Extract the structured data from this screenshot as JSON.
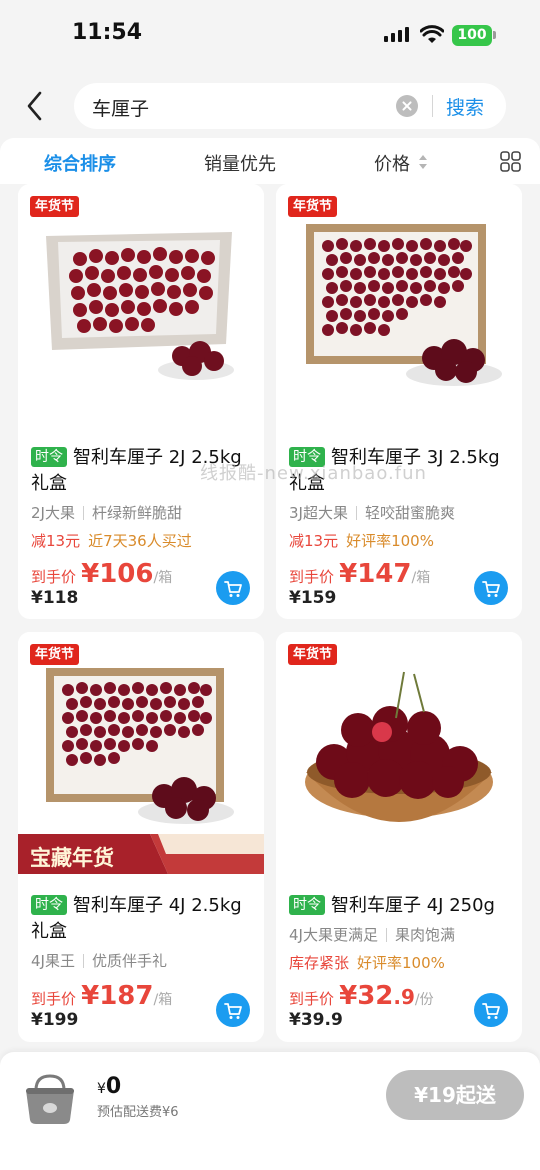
{
  "status_bar": {
    "time": "11:54",
    "battery": "100"
  },
  "search": {
    "query": "车厘子",
    "button_label": "搜索"
  },
  "sort_bar": {
    "tabs": [
      "综合排序",
      "销量优先",
      "价格"
    ]
  },
  "watermark": "线报酷-new.xianbao.fun",
  "products": [
    {
      "tag": "年货节",
      "badge": "时令",
      "title": "智利车厘子 2J 2.5kg礼盒",
      "attr1": "2J大果",
      "attr2": "杆绿新鲜脆甜",
      "promo1": "减13元",
      "promo2": "近7天36人买过",
      "price_label": "到手价",
      "price_currency": "¥",
      "price_int": "106",
      "price_dec": "",
      "price_unit": "/箱",
      "orig_price": "¥118",
      "banner": ""
    },
    {
      "tag": "年货节",
      "badge": "时令",
      "title": "智利车厘子 3J 2.5kg礼盒",
      "attr1": "3J超大果",
      "attr2": "轻咬甜蜜脆爽",
      "promo1": "减13元",
      "promo2": "好评率100%",
      "price_label": "到手价",
      "price_currency": "¥",
      "price_int": "147",
      "price_dec": "",
      "price_unit": "/箱",
      "orig_price": "¥159",
      "banner": ""
    },
    {
      "tag": "年货节",
      "badge": "时令",
      "title": "智利车厘子 4J 2.5kg礼盒",
      "attr1": "4J果王",
      "attr2": "优质伴手礼",
      "promo1": "",
      "promo2": "",
      "price_label": "到手价",
      "price_currency": "¥",
      "price_int": "187",
      "price_dec": "",
      "price_unit": "/箱",
      "orig_price": "¥199",
      "banner": "宝藏年货"
    },
    {
      "tag": "年货节",
      "badge": "时令",
      "title": "智利车厘子 4J 250g",
      "attr1": "4J大果更满足",
      "attr2": "果肉饱满",
      "promo1": "库存紧张",
      "promo2": "好评率100%",
      "price_label": "到手价",
      "price_currency": "¥",
      "price_int": "32",
      "price_dec": ".9",
      "price_unit": "/份",
      "orig_price": "¥39.9",
      "banner": ""
    }
  ],
  "footer": {
    "currency": "¥",
    "total": "0",
    "shipping_note": "预估配送费¥6",
    "min_order_button": "¥19起送"
  },
  "colors": {
    "accent": "#1b8fe8",
    "price": "#e8463b",
    "tag_red": "#e0261c",
    "season_green": "#2fb24c"
  }
}
